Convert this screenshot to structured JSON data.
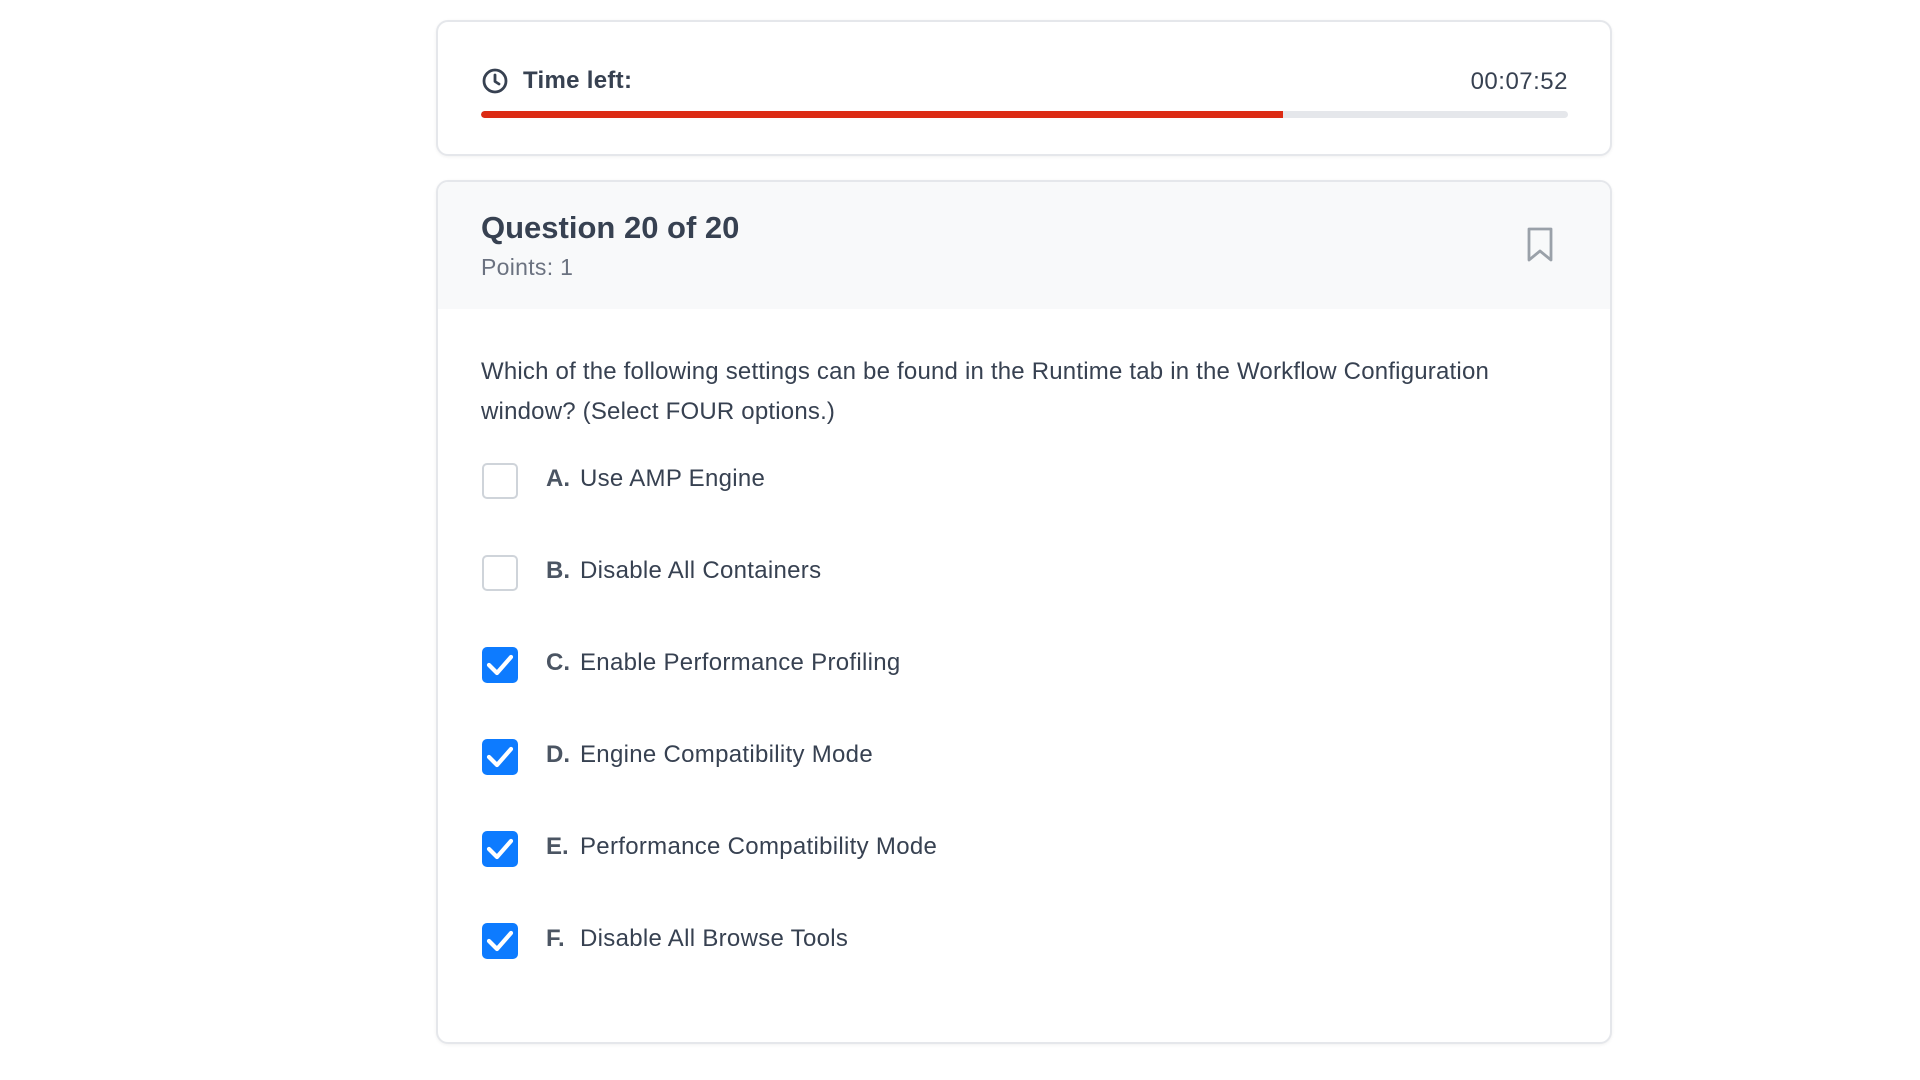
{
  "timer": {
    "label": "Time left:",
    "value": "00:07:52",
    "progress_fraction": 0.738,
    "progress_color": "#dc2b14",
    "icon": "clock-icon"
  },
  "question": {
    "title": "Question 20 of 20",
    "points": "Points: 1",
    "text": "Which of the following settings can be found in the Runtime tab in the Workflow Configuration window? (Select FOUR options.)",
    "bookmark_icon": "bookmark-icon",
    "options": [
      {
        "letter": "A.",
        "text": "Use AMP Engine",
        "checked": false
      },
      {
        "letter": "B.",
        "text": "Disable All Containers",
        "checked": false
      },
      {
        "letter": "C.",
        "text": "Enable Performance Profiling",
        "checked": true
      },
      {
        "letter": "D.",
        "text": "Engine Compatibility Mode",
        "checked": true
      },
      {
        "letter": "E.",
        "text": "Performance Compatibility Mode",
        "checked": true
      },
      {
        "letter": "F.",
        "text": "Disable All Browse Tools",
        "checked": true
      }
    ]
  },
  "colors": {
    "checkbox_checked": "#0d7bff",
    "header_bg": "#f8f9fa"
  }
}
